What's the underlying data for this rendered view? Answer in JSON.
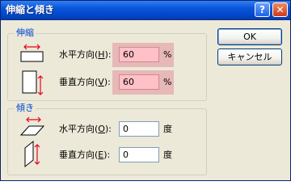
{
  "window": {
    "title": "伸縮と傾き"
  },
  "titlebar": {
    "help_symbol": "?",
    "close_symbol": "✕"
  },
  "stretch_group": {
    "label": "伸縮",
    "horizontal": {
      "label": "水平方向(",
      "mnemonic": "H",
      "suffix": "):",
      "value": "60",
      "unit": "%"
    },
    "vertical": {
      "label": "垂直方向(",
      "mnemonic": "V",
      "suffix": "):",
      "value": "60",
      "unit": "%"
    }
  },
  "skew_group": {
    "label": "傾き",
    "horizontal": {
      "label": "水平方向(",
      "mnemonic": "O",
      "suffix": "):",
      "value": "0",
      "unit": "度"
    },
    "vertical": {
      "label": "垂直方向(",
      "mnemonic": "E",
      "suffix": "):",
      "value": "0",
      "unit": "度"
    }
  },
  "buttons": {
    "ok": "OK",
    "cancel": "キャンセル"
  },
  "colors": {
    "arrow_red": "#e8001c",
    "highlight": "#e6b8b8",
    "title_blue": "#0a55d8"
  },
  "icons": [
    "help-icon",
    "close-icon",
    "stretch-horizontal-icon",
    "stretch-vertical-icon",
    "skew-horizontal-icon",
    "skew-vertical-icon"
  ]
}
